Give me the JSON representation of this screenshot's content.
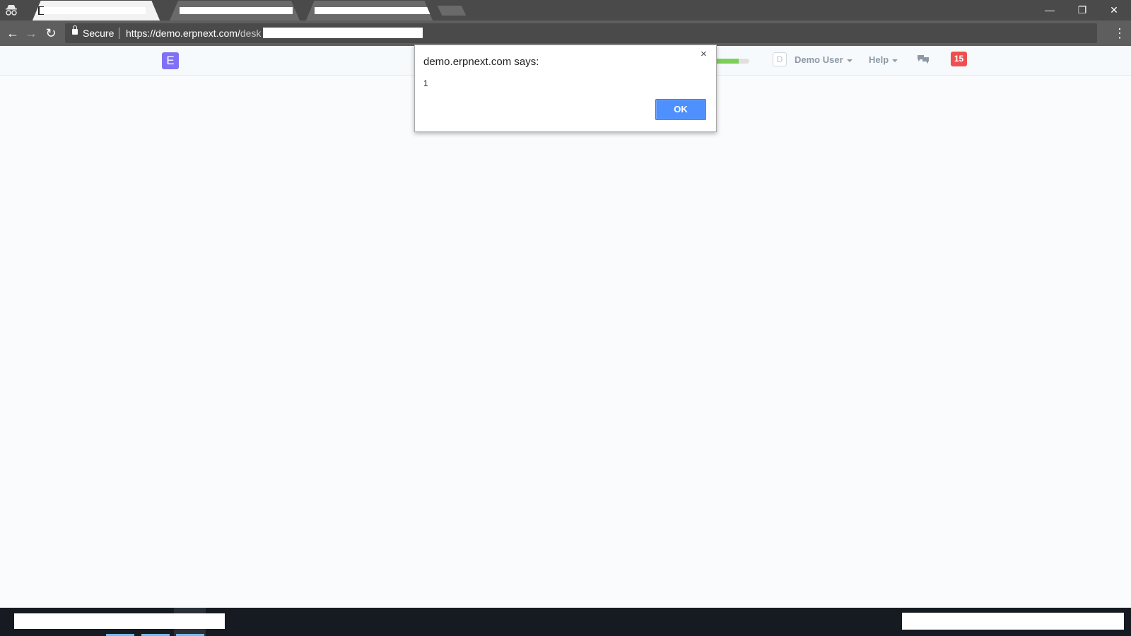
{
  "browser": {
    "tabs": [
      {
        "label": "",
        "active": true
      },
      {
        "label": "",
        "active": false
      },
      {
        "label": "",
        "active": false
      }
    ],
    "window_controls": {
      "minimize": "—",
      "maximize": "❐",
      "close": "✕"
    },
    "nav": {
      "back": "←",
      "forward": "→",
      "reload": "↻"
    },
    "address": {
      "secure_label": "Secure",
      "url_host": "https://demo.erpnext.com/",
      "url_path": "desk"
    },
    "bookmark_icon": "☆",
    "menu_icon": "⋮"
  },
  "app": {
    "logo_letter": "E",
    "logo_color": "#7f70f5",
    "progress_percent": 70,
    "avatar_letter": "D",
    "user_name": "Demo User",
    "help_label": "Help",
    "notification_count": "15"
  },
  "dialog": {
    "title": "demo.erpnext.com says:",
    "message": "1",
    "close_icon": "×",
    "ok_label": "OK"
  }
}
